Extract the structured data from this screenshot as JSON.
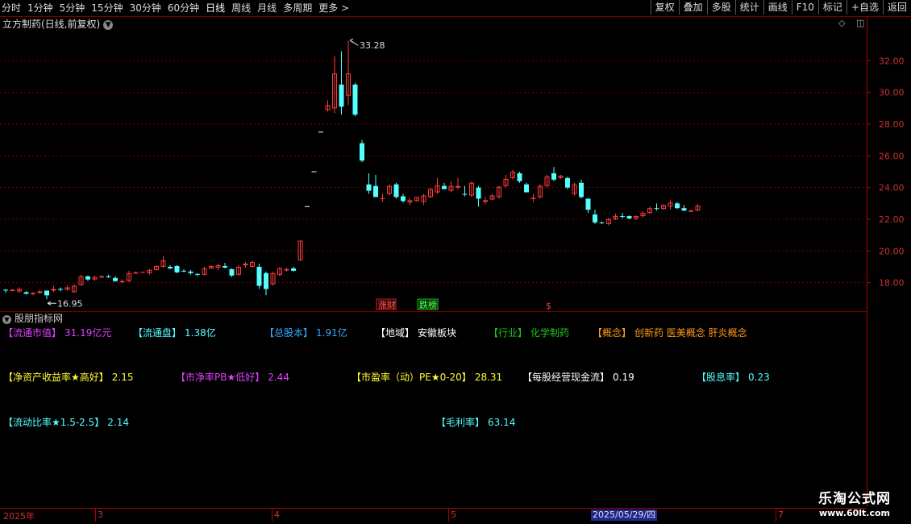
{
  "toolbar": {
    "periods": [
      "分时",
      "1分钟",
      "5分钟",
      "15分钟",
      "30分钟",
      "60分钟",
      "日线",
      "周线",
      "月线",
      "多周期",
      "更多 >"
    ],
    "active_period": "日线",
    "right_buttons": [
      "复权",
      "叠加",
      "多股",
      "统计",
      "画线",
      "F10",
      "标记",
      "+自选",
      "返回"
    ]
  },
  "chart_title": "立方制药(日线,前复权)",
  "indicator_panel_title": "股朋指标网",
  "colors": {
    "up": "#ff3b3b",
    "down": "#54ffff",
    "grid": "#7a0000",
    "axis_text": "#c83232"
  },
  "chart_data": {
    "type": "candlestick",
    "y_ticks": [
      "32.00",
      "30.00",
      "28.00",
      "26.00",
      "24.00",
      "22.00",
      "20.00",
      "18.00"
    ],
    "ylim": [
      16.2,
      33.8
    ],
    "high_label": "33.28",
    "low_label": "16.95",
    "badges": [
      "涨财",
      "跌榜"
    ],
    "candles": [
      [
        17.55,
        17.6,
        17.35,
        17.5
      ],
      [
        17.5,
        17.6,
        17.45,
        17.55
      ],
      [
        17.45,
        17.7,
        17.35,
        17.6
      ],
      [
        17.4,
        17.45,
        17.25,
        17.3
      ],
      [
        17.3,
        17.4,
        17.2,
        17.35
      ],
      [
        17.35,
        17.55,
        17.3,
        17.45
      ],
      [
        17.5,
        17.5,
        16.95,
        17.2
      ],
      [
        17.5,
        17.8,
        17.4,
        17.6
      ],
      [
        17.6,
        17.7,
        17.45,
        17.55
      ],
      [
        17.55,
        17.85,
        17.5,
        17.7
      ],
      [
        17.4,
        17.9,
        17.35,
        17.8
      ],
      [
        17.85,
        18.5,
        17.8,
        18.4
      ],
      [
        18.4,
        18.45,
        18.1,
        18.2
      ],
      [
        18.2,
        18.45,
        18.1,
        18.35
      ],
      [
        18.35,
        18.45,
        18.3,
        18.4
      ],
      [
        18.4,
        18.5,
        18.3,
        18.35
      ],
      [
        18.3,
        18.4,
        18.05,
        18.1
      ],
      [
        18.05,
        18.2,
        17.95,
        18.1
      ],
      [
        18.1,
        18.75,
        18.05,
        18.6
      ],
      [
        18.6,
        18.7,
        18.55,
        18.65
      ],
      [
        18.65,
        18.7,
        18.6,
        18.65
      ],
      [
        18.6,
        18.85,
        18.5,
        18.8
      ],
      [
        18.8,
        19.1,
        18.75,
        19.05
      ],
      [
        19.0,
        19.7,
        18.95,
        19.4
      ],
      [
        19.0,
        19.1,
        18.85,
        18.9
      ],
      [
        19.05,
        19.1,
        18.6,
        18.65
      ],
      [
        18.75,
        18.85,
        18.65,
        18.7
      ],
      [
        18.7,
        18.8,
        18.5,
        18.6
      ],
      [
        18.55,
        18.6,
        18.4,
        18.5
      ],
      [
        18.5,
        19.0,
        18.45,
        18.9
      ],
      [
        18.9,
        19.1,
        18.85,
        19.05
      ],
      [
        18.95,
        19.2,
        18.8,
        19.1
      ],
      [
        19.05,
        19.25,
        18.9,
        18.95
      ],
      [
        18.85,
        18.9,
        18.35,
        18.45
      ],
      [
        18.5,
        19.1,
        18.45,
        19.0
      ],
      [
        19.1,
        19.3,
        18.95,
        19.2
      ],
      [
        19.0,
        19.4,
        18.95,
        19.3
      ],
      [
        19.0,
        19.2,
        17.6,
        17.8
      ],
      [
        18.6,
        18.7,
        17.2,
        17.6
      ],
      [
        17.9,
        18.7,
        17.8,
        18.6
      ],
      [
        18.5,
        19.0,
        18.4,
        18.9
      ],
      [
        18.8,
        18.95,
        18.7,
        18.85
      ],
      [
        18.9,
        19.0,
        18.7,
        18.75
      ],
      [
        19.4,
        20.65,
        19.4,
        20.65
      ],
      [
        22.8,
        22.8,
        22.8,
        22.8
      ],
      [
        25.0,
        25.0,
        25.0,
        25.0
      ],
      [
        27.5,
        27.5,
        27.5,
        27.5
      ],
      [
        28.9,
        29.5,
        28.8,
        29.2
      ],
      [
        29.0,
        32.3,
        28.7,
        31.2
      ],
      [
        30.5,
        32.6,
        28.6,
        29.1
      ],
      [
        29.8,
        33.28,
        29.2,
        31.2
      ],
      [
        30.5,
        30.6,
        28.5,
        28.6
      ],
      [
        26.8,
        27.0,
        25.6,
        25.7
      ],
      [
        24.2,
        24.9,
        23.6,
        23.8
      ],
      [
        24.1,
        24.8,
        23.4,
        23.4
      ],
      [
        23.3,
        23.6,
        23.1,
        23.3
      ],
      [
        23.6,
        24.2,
        23.5,
        24.1
      ],
      [
        24.2,
        24.3,
        23.3,
        23.4
      ],
      [
        23.45,
        23.6,
        23.05,
        23.15
      ],
      [
        23.05,
        23.3,
        22.9,
        23.2
      ],
      [
        23.15,
        23.4,
        23.1,
        23.4
      ],
      [
        23.1,
        23.6,
        22.9,
        23.5
      ],
      [
        23.4,
        24.0,
        23.35,
        23.9
      ],
      [
        23.7,
        24.6,
        23.6,
        24.15
      ],
      [
        24.1,
        24.3,
        23.9,
        23.9
      ],
      [
        23.8,
        24.4,
        23.7,
        24.1
      ],
      [
        24.0,
        24.6,
        23.9,
        24.1
      ],
      [
        23.6,
        24.1,
        23.45,
        23.55
      ],
      [
        23.5,
        24.4,
        23.4,
        24.3
      ],
      [
        24.0,
        24.1,
        22.8,
        23.3
      ],
      [
        23.1,
        23.4,
        22.95,
        23.2
      ],
      [
        23.25,
        23.6,
        23.2,
        23.5
      ],
      [
        23.4,
        24.1,
        23.3,
        24.05
      ],
      [
        24.1,
        24.8,
        24.0,
        24.55
      ],
      [
        24.6,
        25.1,
        24.5,
        25.0
      ],
      [
        24.9,
        25.0,
        24.3,
        24.4
      ],
      [
        24.2,
        24.3,
        23.7,
        23.7
      ],
      [
        23.3,
        23.6,
        23.1,
        23.35
      ],
      [
        23.4,
        24.2,
        23.3,
        24.1
      ],
      [
        24.1,
        24.8,
        24.0,
        24.7
      ],
      [
        24.9,
        25.3,
        24.4,
        24.5
      ],
      [
        24.6,
        24.8,
        24.55,
        24.75
      ],
      [
        24.6,
        24.7,
        23.9,
        24.0
      ],
      [
        23.6,
        24.3,
        23.5,
        24.2
      ],
      [
        24.3,
        24.5,
        23.3,
        23.4
      ],
      [
        23.3,
        23.3,
        22.4,
        22.6
      ],
      [
        22.3,
        22.6,
        21.7,
        21.8
      ],
      [
        21.8,
        21.85,
        21.7,
        21.75
      ],
      [
        21.7,
        22.1,
        21.6,
        22.0
      ],
      [
        22.0,
        22.35,
        21.95,
        22.2
      ],
      [
        22.2,
        22.4,
        22.05,
        22.15
      ],
      [
        22.2,
        22.25,
        22.0,
        22.05
      ],
      [
        22.05,
        22.25,
        21.95,
        22.2
      ],
      [
        22.2,
        22.5,
        22.1,
        22.4
      ],
      [
        22.4,
        22.8,
        22.35,
        22.7
      ],
      [
        22.7,
        23.0,
        22.55,
        22.65
      ],
      [
        22.65,
        22.95,
        22.6,
        22.9
      ],
      [
        22.8,
        23.2,
        22.6,
        23.05
      ],
      [
        23.0,
        23.1,
        22.65,
        22.7
      ],
      [
        22.7,
        22.9,
        22.5,
        22.55
      ],
      [
        22.5,
        22.6,
        22.45,
        22.55
      ],
      [
        22.55,
        22.95,
        22.5,
        22.85
      ]
    ]
  },
  "info_rows": [
    [
      {
        "key": "【流通市值】",
        "value": "31.19亿元",
        "color": "#e040ff"
      },
      {
        "key": "【流通盘】",
        "value": "1.38亿",
        "color": "#54ffff"
      },
      {
        "key": "【总股本】",
        "value": "1.91亿",
        "color": "#33aaff"
      },
      {
        "key": "【地域】",
        "value": "安徽板块",
        "color": "#ffffff"
      },
      {
        "key": "【行业】",
        "value": "化学制药",
        "color": "#1fc21f"
      },
      {
        "key": "【概念】",
        "value": "创新药 医美概念 肝炎概念",
        "color": "#ff9a1a"
      }
    ],
    [
      {
        "key": "【净资产收益率★高好】",
        "value": "2.15",
        "color": "#ffff33"
      },
      {
        "key": "【市净率PB★低好】",
        "value": "2.44",
        "color": "#e040ff"
      },
      {
        "key": "【市盈率（动）PE★0-20】",
        "value": "28.31",
        "color": "#ffff33"
      },
      {
        "key": "【每股经营现金流】",
        "value": "0.19",
        "color": "#ffffff"
      },
      {
        "key": "【股息率】",
        "value": "0.23",
        "color": "#54ffff"
      }
    ],
    [
      {
        "key": "【流动比率★1.5-2.5】",
        "value": "2.14",
        "color": "#54ffff"
      },
      {
        "key": "【毛利率】",
        "value": "63.14",
        "color": "#54ffff"
      }
    ]
  ],
  "date_axis": {
    "labels": [
      "2025年",
      "3",
      "4",
      "5",
      "2025/05/29/四",
      "7"
    ]
  },
  "watermark": {
    "line1": "乐淘公式网",
    "line2": "www.60lt.com"
  }
}
